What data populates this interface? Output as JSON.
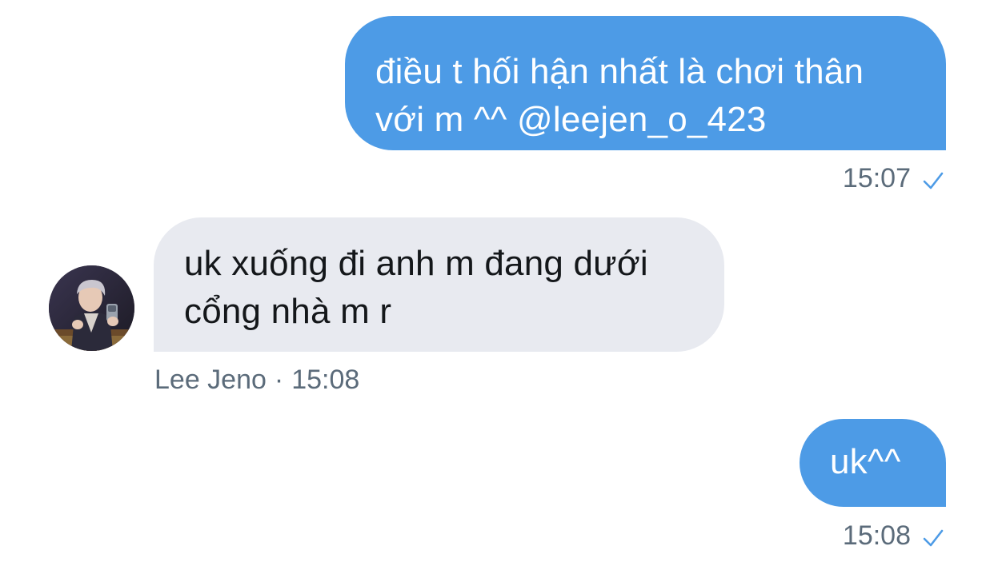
{
  "conversation": {
    "messages": [
      {
        "direction": "outgoing",
        "text": "điều t hối hận nhất là chơi thân\nvới m ^^ @leejen_o_423",
        "time": "15:07",
        "status_icon": "check-icon"
      },
      {
        "direction": "incoming",
        "sender": "Lee Jeno",
        "text": "uk xuống đi anh m đang dưới\ncổng nhà m r",
        "time": "15:08",
        "separator": "·",
        "avatar_icon": "avatar-photo"
      },
      {
        "direction": "outgoing",
        "text": "uk^^",
        "time": "15:08",
        "status_icon": "check-icon"
      }
    ]
  },
  "colors": {
    "outgoing_bubble": "#4d9be6",
    "incoming_bubble": "#e8eaf0",
    "meta_text": "#5b6b7a",
    "check": "#4d9be6"
  }
}
